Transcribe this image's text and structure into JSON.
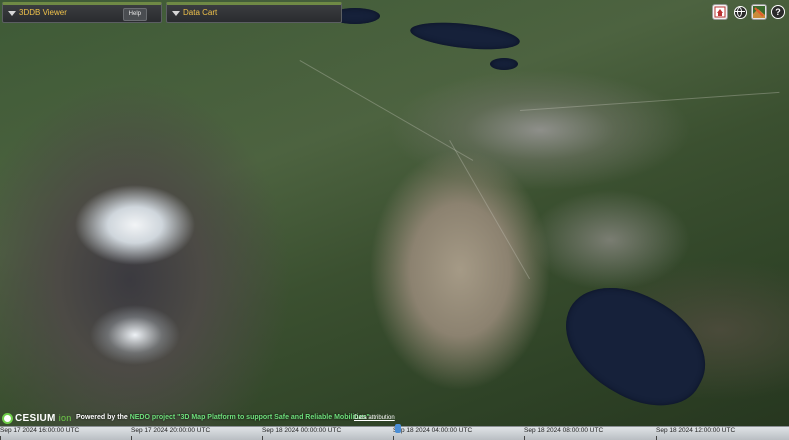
{
  "panels": {
    "viewer": {
      "title": "3DDB Viewer",
      "help_label": "Help"
    },
    "cart": {
      "title": "Data Cart"
    }
  },
  "toolbar": {
    "home_icon": "home-icon",
    "globe_icon": "globe-icon",
    "layers_icon": "layers-icon",
    "help_icon": "help-icon",
    "help_glyph": "?"
  },
  "credits": {
    "logo_main": "CESIUM",
    "logo_suffix": "ion",
    "powered_prefix": "Powered by the ",
    "powered_highlight": "NEDO project \"3D Map Platform to support Safe and Reliable Mobilities\"",
    "data_attribution": "Data attribution"
  },
  "timeline": {
    "labels": [
      "Sep 17 2024 16:00:00 UTC",
      "Sep 17 2024 20:00:00 UTC",
      "Sep 18 2024 00:00:00 UTC",
      "Sep 18 2024 04:00:00 UTC",
      "Sep 18 2024 08:00:00 UTC",
      "Sep 18 2024 12:00:00 UTC"
    ]
  },
  "colors": {
    "panel_accent": "#6f8a45",
    "panel_title": "#f0c24a",
    "cesium_green": "#6fcf4a",
    "timeline_needle": "#4b8fd6"
  }
}
